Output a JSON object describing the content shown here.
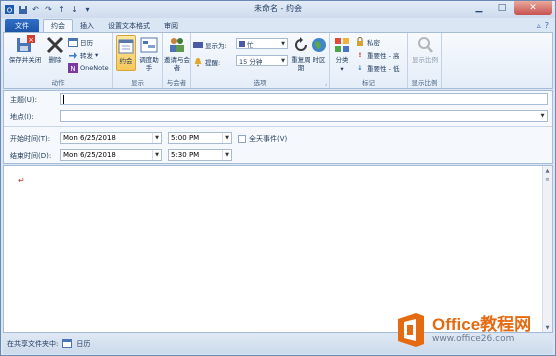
{
  "window": {
    "title": "未命名 - 约会",
    "controls": [
      "minimize",
      "maximize",
      "close"
    ]
  },
  "quick_access": [
    "save-icon",
    "undo-icon",
    "redo-icon",
    "up-arrow-icon",
    "down-arrow-icon",
    "customize-icon"
  ],
  "tabs": [
    {
      "label": "文件"
    },
    {
      "label": "约会"
    },
    {
      "label": "插入"
    },
    {
      "label": "设置文本格式"
    },
    {
      "label": "审阅"
    }
  ],
  "ribbon": {
    "groups": {
      "actions": {
        "label": "动作",
        "save_close": "保存并关闭",
        "delete": "删除",
        "calendar": "日历",
        "forward": "转发",
        "onenote": "OneNote"
      },
      "show": {
        "label": "显示",
        "appointment": "约会",
        "scheduling": "调度助手"
      },
      "attendees": {
        "label": "与会者",
        "invite": "邀请与会者"
      },
      "options": {
        "label": "选项",
        "show_as_label": "显示为:",
        "show_as_value": "忙",
        "reminder_label": "提醒:",
        "reminder_value": "15 分钟",
        "recurrence": "重复周期",
        "timezone": "时区"
      },
      "tags": {
        "label": "标记",
        "categorize": "分类",
        "private": "私密",
        "high_importance": "重要性 - 高",
        "low_importance": "重要性 - 低"
      },
      "zoom": {
        "label": "显示比例",
        "zoom": "显示比例"
      }
    }
  },
  "form": {
    "subject_label": "主题(U):",
    "subject_value": "",
    "location_label": "地点(I):",
    "location_value": "",
    "start_label": "开始时间(T):",
    "start_date": "Mon 6/25/2018",
    "start_time": "5:00 PM",
    "all_day_label": "全天事件(V)",
    "all_day_checked": false,
    "end_label": "结束时间(D):",
    "end_date": "Mon 6/25/2018",
    "end_time": "5:30 PM"
  },
  "body": {
    "text": "↵"
  },
  "statusbar": {
    "shared_label": "在共享文件夹中:",
    "folder": "日历"
  },
  "watermark": {
    "main": "Office教程网",
    "sub": "www.office26.com"
  },
  "colors": {
    "accent": "#2f6fc7",
    "ribbon_bg": "#e4edf8",
    "selected": "#f8c85a",
    "watermark": "#e46b12"
  }
}
